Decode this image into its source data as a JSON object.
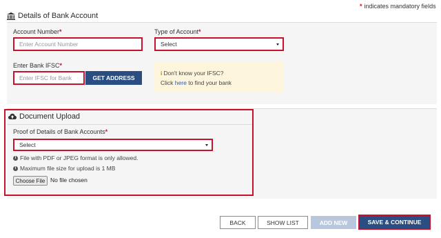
{
  "mandatory_note": {
    "star": "*",
    "text": "indicates mandatory fields"
  },
  "bank_section": {
    "title": "Details of Bank Account",
    "account_number": {
      "label": "Account Number",
      "star": "*",
      "placeholder": "Enter Account Number"
    },
    "account_type": {
      "label": "Type of Account",
      "star": "*",
      "value": "Select"
    },
    "ifsc": {
      "label": "Enter Bank IFSC",
      "star": "*",
      "placeholder": "Enter IFSC for Bank",
      "button": "GET ADDRESS"
    },
    "ifsc_help": {
      "line1": "Don't know your IFSC?",
      "click": "Click",
      "here": "here",
      "rest": "to find your bank"
    }
  },
  "document_section": {
    "title": "Document Upload",
    "proof": {
      "label": "Proof of Details of Bank Accounts",
      "star": "*",
      "value": "Select"
    },
    "notes": [
      "File with PDF or JPEG format is only allowed.",
      "Maximum file size for upload is 1 MB"
    ],
    "file": {
      "button": "Choose File",
      "status": "No file chosen"
    }
  },
  "footer": {
    "back": "BACK",
    "show_list": "SHOW LIST",
    "add_new": "ADD NEW",
    "save_continue": "SAVE & CONTINUE"
  },
  "colors": {
    "accent_red": "#c9102b",
    "primary_blue": "#2a4e82",
    "disabled_blue": "#b9c7dc",
    "info_bg": "#fdf6dc"
  }
}
